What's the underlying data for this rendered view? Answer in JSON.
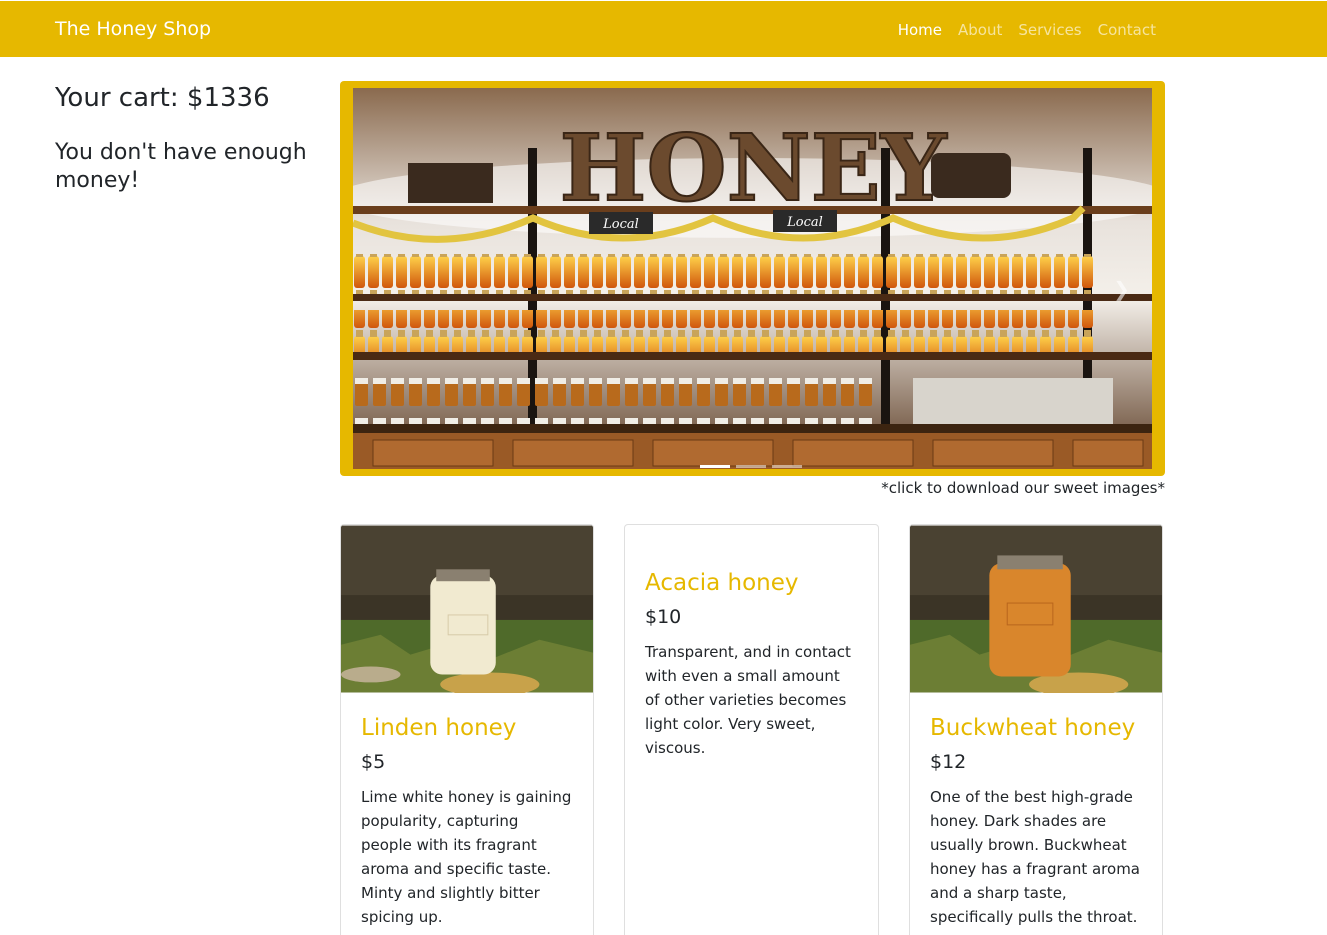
{
  "navbar": {
    "brand": "The Honey Shop",
    "links": [
      {
        "label": "Home",
        "active": true
      },
      {
        "label": "About",
        "active": false
      },
      {
        "label": "Services",
        "active": false
      },
      {
        "label": "Contact",
        "active": false
      }
    ],
    "color": "#e6b800"
  },
  "cart": {
    "total_text": "Your cart: $1336",
    "message": "You don't have enough money!"
  },
  "carousel": {
    "image_caption": "*click to download our sweet images*",
    "indicator_count": 3,
    "active_indicator": 1,
    "sign_text": "HONEY",
    "shelf_label": "Local"
  },
  "products": [
    {
      "title": "Linden honey",
      "price": "$5",
      "description": "Lime white honey is gaining popularity, capturing people with its fragrant aroma and specific taste. Minty and slightly bitter spicing up.",
      "has_image": true,
      "jar_color": "#f1ead0"
    },
    {
      "title": "Acacia honey",
      "price": "$10",
      "description": "Transparent, and in contact with even a small amount of other varieties becomes light color. Very sweet, viscous.",
      "has_image": false
    },
    {
      "title": "Buckwheat honey",
      "price": "$12",
      "description": "One of the best high-grade honey. Dark shades are usually brown. Buckwheat honey has a fragrant aroma and a sharp taste, specifically pulls the throat.",
      "has_image": true,
      "jar_color": "#d9862c"
    }
  ]
}
